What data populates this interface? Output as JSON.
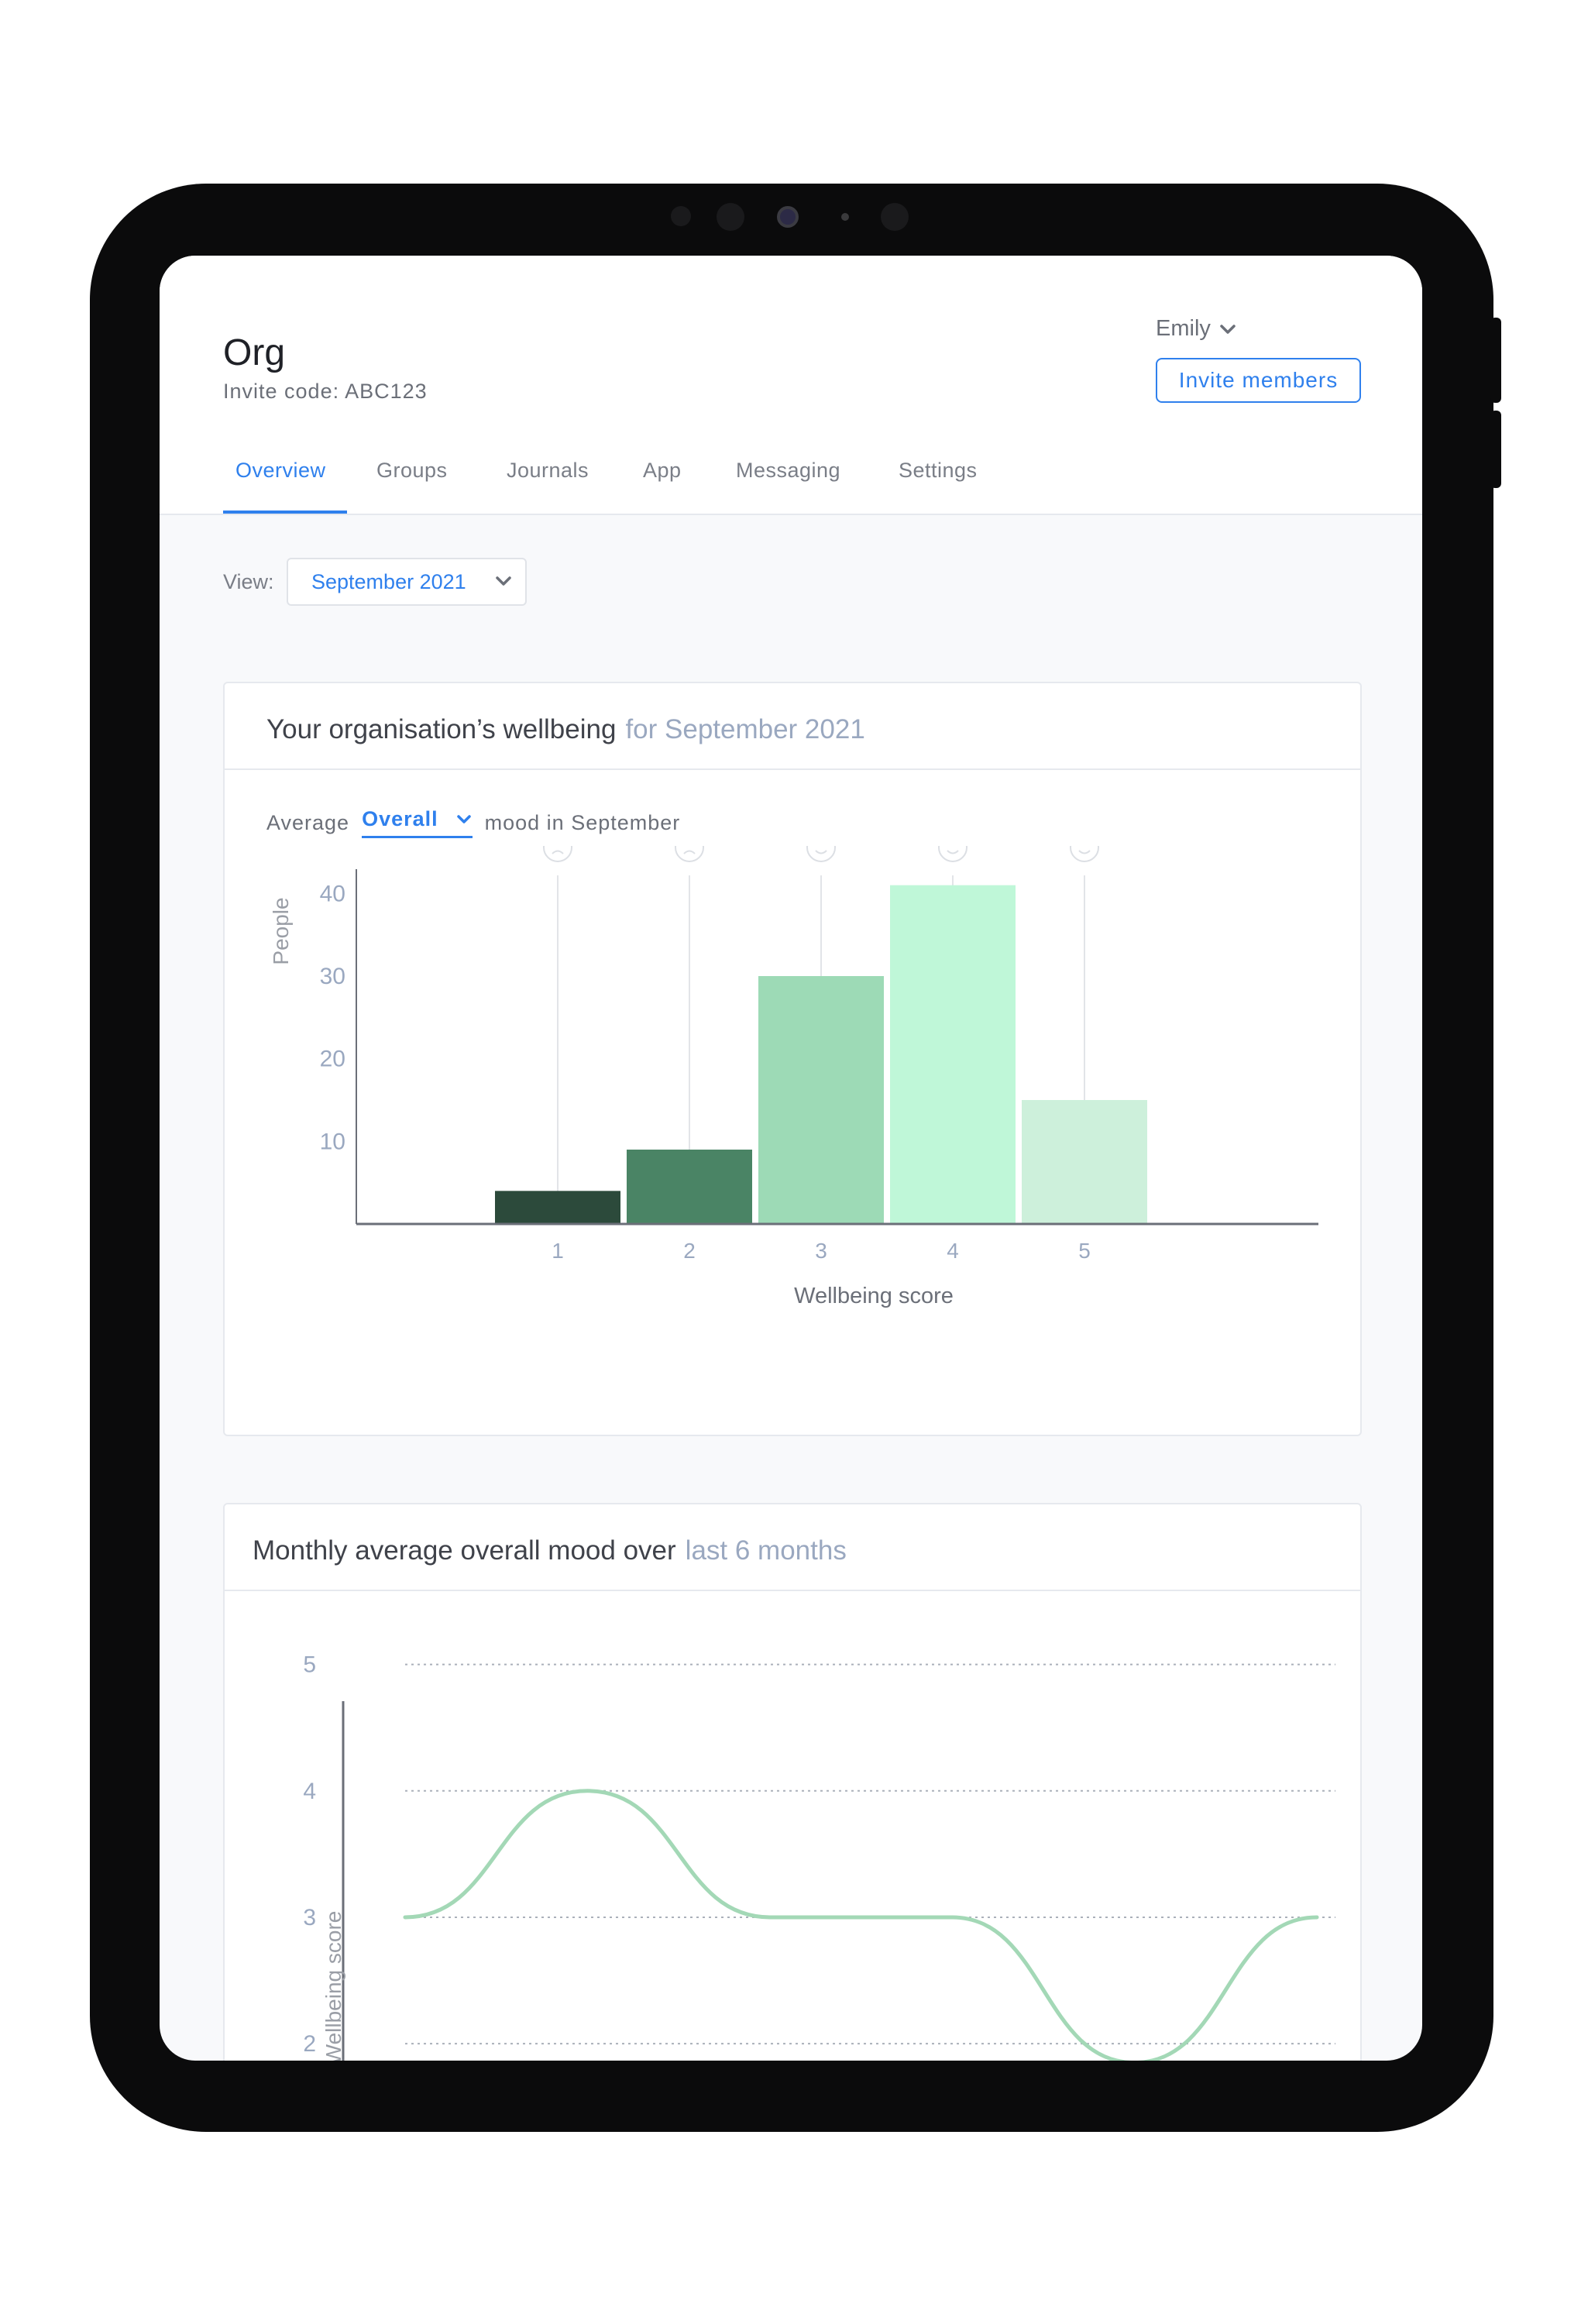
{
  "header": {
    "org_name": "Org",
    "invite_code": "Invite code: ABC123",
    "user_name": "Emily",
    "invite_button": "Invite members"
  },
  "tabs": [
    {
      "label": "Overview",
      "active": true
    },
    {
      "label": "Groups"
    },
    {
      "label": "Journals"
    },
    {
      "label": "App"
    },
    {
      "label": "Messaging"
    },
    {
      "label": "Settings"
    }
  ],
  "view": {
    "label": "View:",
    "selected": "September 2021"
  },
  "wellbeing_card": {
    "title": "Your organisation’s wellbeing",
    "title_accent": "for September 2021",
    "average_label": "Average",
    "metric_selected": "Overall",
    "suffix": "mood in September"
  },
  "trend_card": {
    "title": "Monthly average overall mood over",
    "title_accent": "last 6 months"
  },
  "chart_data": [
    {
      "type": "bar",
      "categories": [
        "1",
        "2",
        "3",
        "4",
        "5"
      ],
      "values": [
        4,
        9,
        30,
        41,
        15
      ],
      "colors": [
        "#2c4a3b",
        "#4a8465",
        "#9ddab6",
        "#bff7d8",
        "#cdf0db"
      ],
      "xlabel": "Wellbeing score",
      "ylabel": "People",
      "yticks": [
        10,
        20,
        30,
        40
      ],
      "ylim": [
        0,
        42
      ]
    },
    {
      "type": "line",
      "values": [
        3,
        4,
        3,
        3,
        1.85,
        3
      ],
      "color": "#a3d8b6",
      "ylabel": "Wellbeing score",
      "yticks": [
        2,
        3,
        4,
        5
      ],
      "ylim": [
        1.4,
        5.2
      ],
      "grid": true
    }
  ]
}
